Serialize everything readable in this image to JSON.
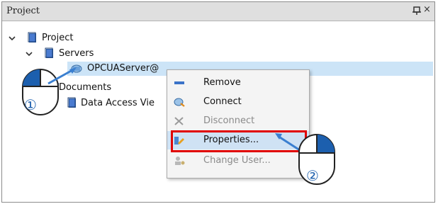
{
  "panel": {
    "title": "Project"
  },
  "tree": {
    "root": "Project",
    "servers": "Servers",
    "server_item": "OPCUAServer@",
    "documents": "Documents",
    "data_access": "Data Access Vie"
  },
  "context_menu": {
    "items": [
      {
        "label": "Remove",
        "icon": "remove-icon",
        "enabled": true
      },
      {
        "label": "Connect",
        "icon": "connect-icon",
        "enabled": true
      },
      {
        "label": "Disconnect",
        "icon": "disconnect-icon",
        "enabled": false
      },
      {
        "label": "Properties...",
        "icon": "properties-icon",
        "enabled": true,
        "highlighted": true
      },
      {
        "label": "Change User...",
        "icon": "change-user-icon",
        "enabled": false
      }
    ]
  },
  "annotations": {
    "step1": "①",
    "step2": "②",
    "highlight_color": "#e00000",
    "arrow_color": "#3a7fd0"
  }
}
